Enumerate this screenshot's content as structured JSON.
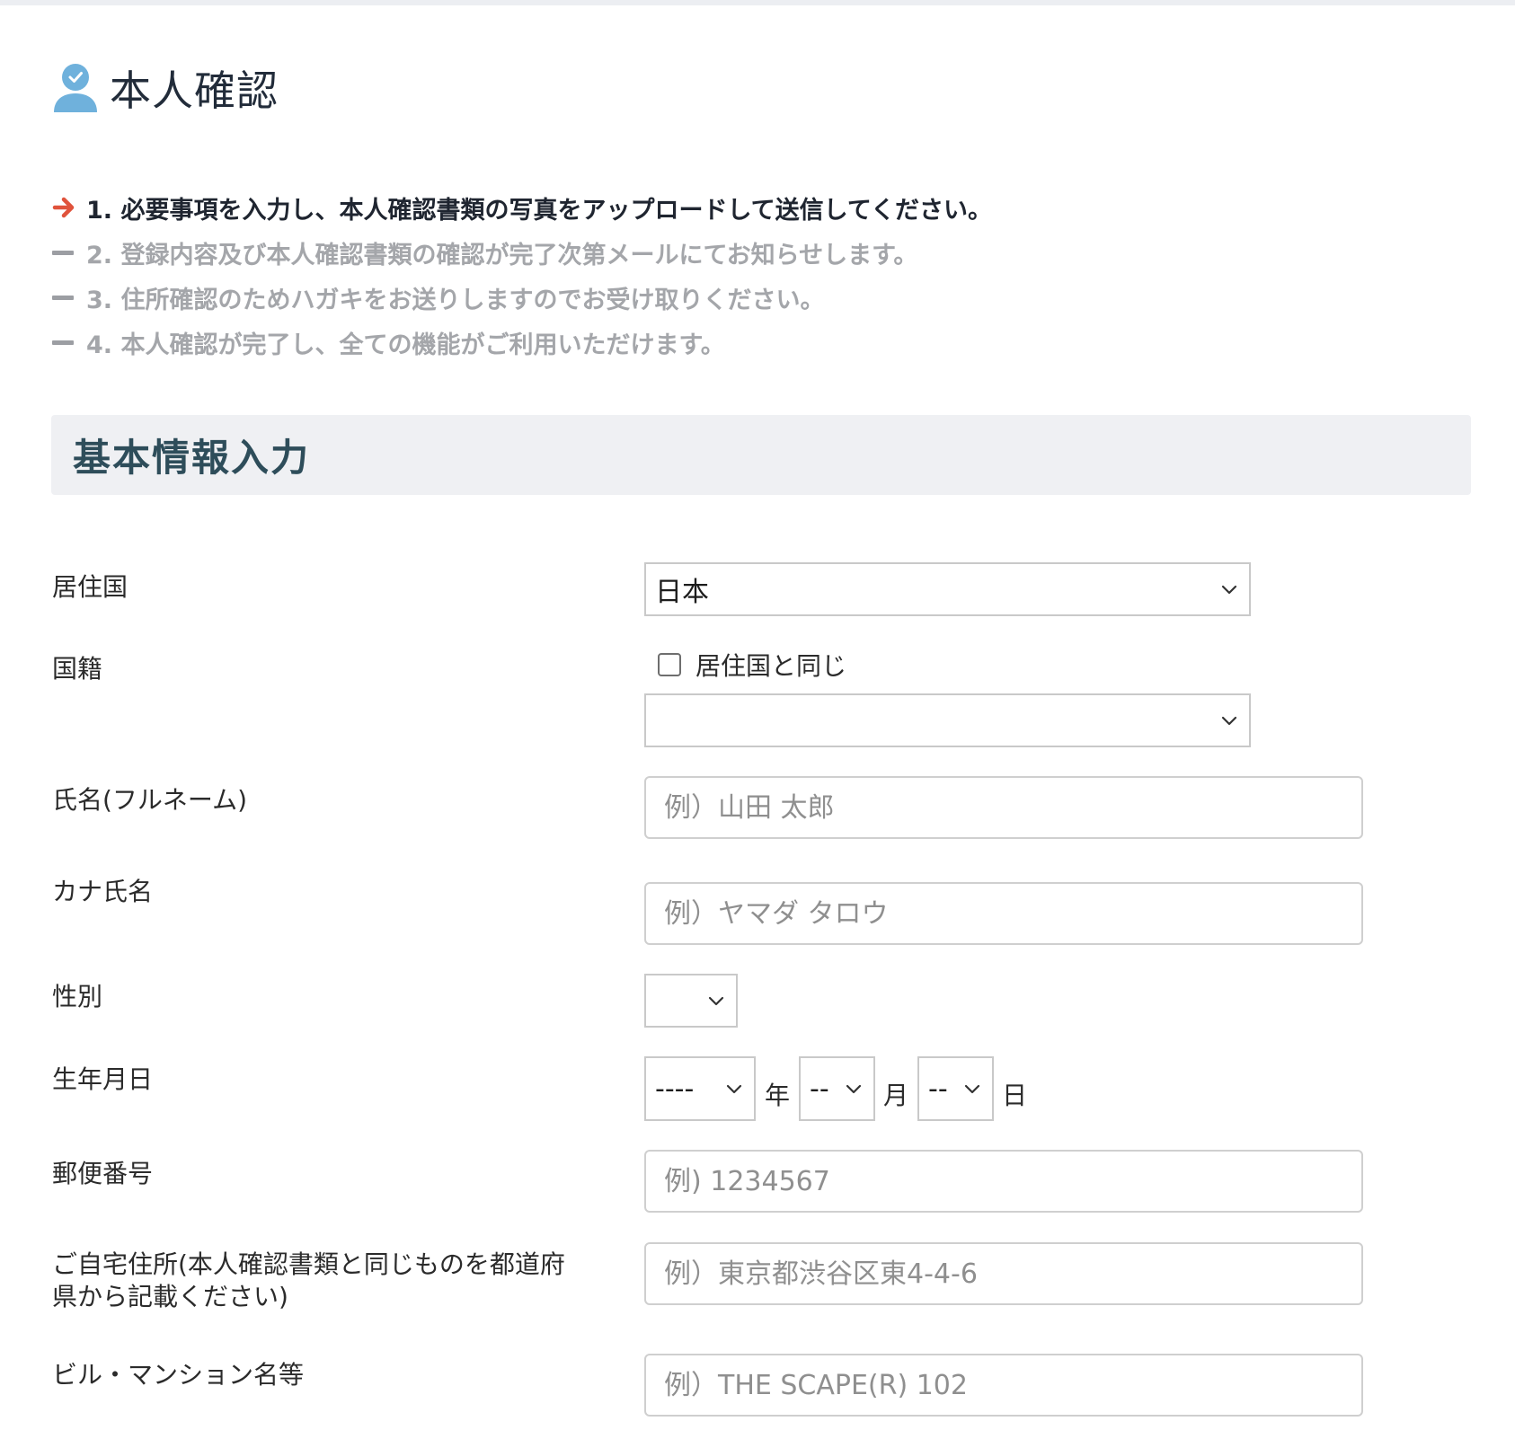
{
  "page": {
    "title": "本人確認"
  },
  "steps": [
    {
      "text": "1. 必要事項を入力し、本人確認書類の写真をアップロードして送信してください。",
      "state": "active"
    },
    {
      "text": "2. 登録内容及び本人確認書類の確認が完了次第メールにてお知らせします。",
      "state": "pending"
    },
    {
      "text": "3. 住所確認のためハガキをお送りしますのでお受け取りください。",
      "state": "pending"
    },
    {
      "text": "4. 本人確認が完了し、全ての機能がご利用いただけます。",
      "state": "pending"
    }
  ],
  "section": {
    "title": "基本情報入力"
  },
  "form": {
    "residence": {
      "label": "居住国",
      "value": "日本"
    },
    "nationality": {
      "label": "国籍",
      "checkbox_label": "居住国と同じ",
      "checked": false,
      "value": ""
    },
    "full_name": {
      "label": "氏名(フルネーム)",
      "placeholder": "例）山田 太郎"
    },
    "kana_name": {
      "label": "カナ氏名",
      "placeholder": "例）ヤマダ タロウ"
    },
    "gender": {
      "label": "性別",
      "value": ""
    },
    "birthdate": {
      "label": "生年月日",
      "year_value": "----",
      "year_unit": "年",
      "month_value": "--",
      "month_unit": "月",
      "day_value": "--",
      "day_unit": "日"
    },
    "postal_code": {
      "label": "郵便番号",
      "placeholder": "例) 1234567"
    },
    "address": {
      "label_line1": "ご自宅住所(本人確認書類と同じものを都道府",
      "label_line2": "県から記載ください)",
      "placeholder": "例）東京都渋谷区東4-4-6"
    },
    "building": {
      "label": "ビル・マンション名等",
      "placeholder": "例）THE SCAPE(R) 102"
    }
  },
  "colors": {
    "accent_arrow": "#e0533c",
    "section_title": "#2e4d5a",
    "avatar": "#6fb1dc"
  },
  "icons": {
    "header": "verified-user-icon",
    "active_step": "arrow-right-icon",
    "pending_step": "dash-icon",
    "select": "chevron-down-icon"
  }
}
